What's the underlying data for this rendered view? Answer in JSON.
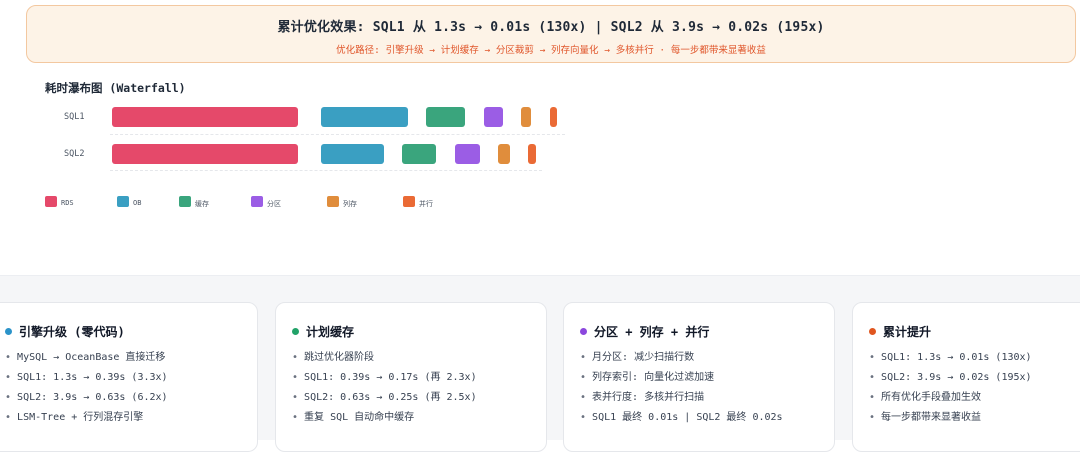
{
  "banner": {
    "title": "累计优化效果: SQL1 从 1.3s → 0.01s (130x) | SQL2 从 3.9s → 0.02s (195x)",
    "subtitle": "优化路径: 引擎升级 → 计划缓存 → 分区裁剪 → 列存向量化 → 多核并行 · 每一步都带来显著收益"
  },
  "waterfall": {
    "title": "耗时瀑布图 (Waterfall)",
    "rows": [
      {
        "label": "SQL1"
      },
      {
        "label": "SQL2"
      }
    ],
    "legend": [
      {
        "label": "RDS",
        "color": "#e5496a"
      },
      {
        "label": "OB",
        "color": "#3a9fc2"
      },
      {
        "label": "缓存",
        "color": "#3aa57d"
      },
      {
        "label": "分区",
        "color": "#9b5de5"
      },
      {
        "label": "列存",
        "color": "#e08d3c"
      },
      {
        "label": "并行",
        "color": "#ea6a35"
      }
    ]
  },
  "cards": [
    {
      "title": "引擎升级 (零代码)",
      "dot_color": "#2b93c9",
      "items": [
        "MySQL → OceanBase 直接迁移",
        "SQL1: 1.3s → 0.39s (3.3x)",
        "SQL2: 3.9s → 0.63s (6.2x)",
        "LSM-Tree + 行列混存引擎"
      ]
    },
    {
      "title": "计划缓存",
      "dot_color": "#21a268",
      "items": [
        "跳过优化器阶段",
        "SQL1: 0.39s → 0.17s (再 2.3x)",
        "SQL2: 0.63s → 0.25s (再 2.5x)",
        "重复 SQL 自动命中缓存"
      ]
    },
    {
      "title": "分区 + 列存 + 并行",
      "dot_color": "#8b47dd",
      "items": [
        "月分区: 减少扫描行数",
        "列存索引: 向量化过滤加速",
        "表并行度: 多核并行扫描",
        "SQL1 最终 0.01s | SQL2 最终 0.02s"
      ]
    },
    {
      "title": "累计提升",
      "dot_color": "#e0561f",
      "items": [
        "SQL1: 1.3s → 0.01s (130x)",
        "SQL2: 3.9s → 0.02s (195x)",
        "所有优化手段叠加生效",
        "每一步都带来显著收益"
      ]
    }
  ]
}
